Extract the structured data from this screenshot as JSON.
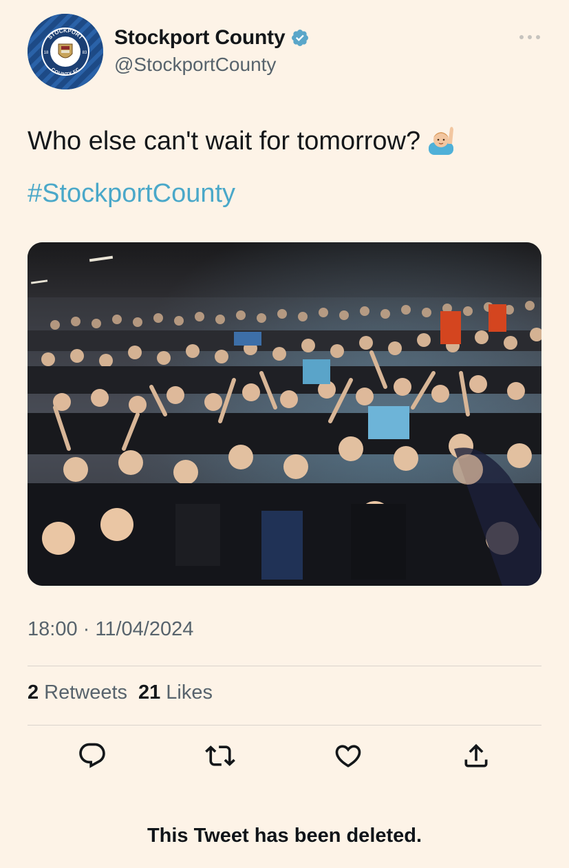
{
  "tweet": {
    "author": {
      "display_name": "Stockport County",
      "handle": "@StockportCounty",
      "verified": true,
      "avatar_icon": "club-crest-icon",
      "avatar_text": {
        "top": "STOCKPORT",
        "bottom": "COUNTY FC",
        "left": "18",
        "right": "83"
      }
    },
    "text": "Who else can't wait for tomorrow?",
    "emoji": "raising-hand-emoji",
    "hashtag": "#StockportCounty",
    "media": {
      "type": "photo"
    },
    "timestamp": "18:00 · 11/04/2024",
    "stats": {
      "retweets_count": "2",
      "retweets_label": "Retweets",
      "likes_count": "21",
      "likes_label": "Likes"
    },
    "actions": [
      {
        "icon": "reply-icon"
      },
      {
        "icon": "retweet-icon"
      },
      {
        "icon": "like-icon"
      },
      {
        "icon": "share-icon"
      }
    ],
    "notice": "This Tweet has been deleted."
  },
  "colors": {
    "background": "#fdf3e7",
    "text": "#14171a",
    "secondary_text": "#57636c",
    "hashtag": "#4aa8c9",
    "verified": "#5aa6c9",
    "divider": "#d9d3cc"
  }
}
